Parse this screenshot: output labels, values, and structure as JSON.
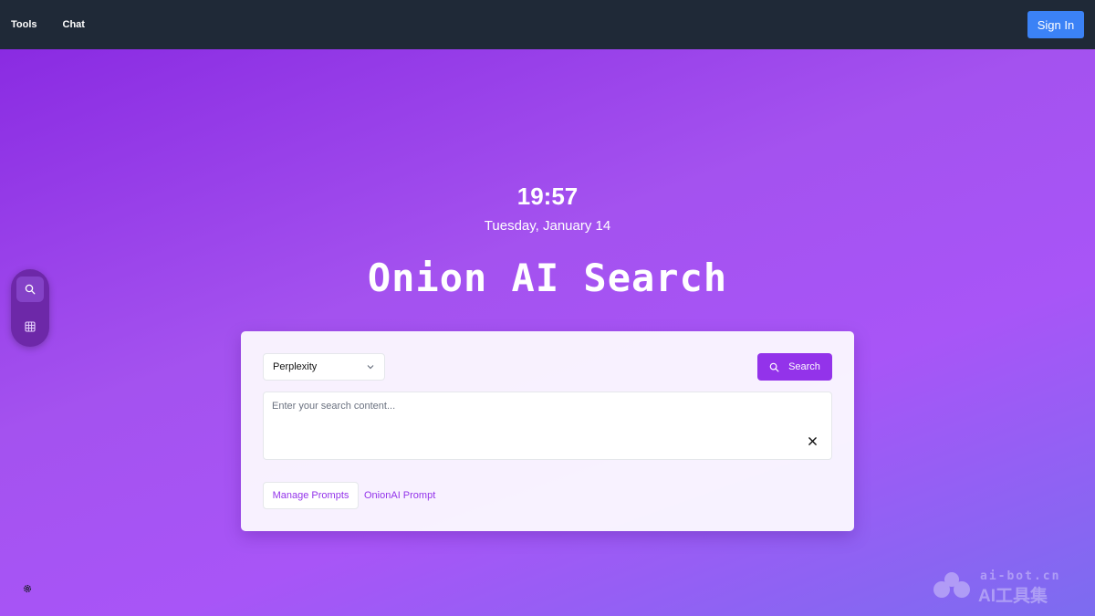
{
  "header": {
    "nav": [
      "Tools",
      "Chat"
    ],
    "sign_in_label": "Sign In"
  },
  "clock": {
    "time": "19:57",
    "date": "Tuesday, January 14"
  },
  "brand": {
    "title": "Onion AI Search"
  },
  "sidebar": {
    "items": [
      {
        "icon": "search-icon",
        "active": true
      },
      {
        "icon": "grid-icon",
        "active": false
      }
    ]
  },
  "search": {
    "engine": "Perplexity",
    "button_label": "Search",
    "placeholder": "Enter your search content...",
    "value": ""
  },
  "prompts": {
    "manage_label": "Manage Prompts",
    "link_label": "OnionAI Prompt"
  },
  "watermark": {
    "url": "ai-bot.cn",
    "name": "AI工具集"
  },
  "colors": {
    "topbar": "#1f2937",
    "accent": "#9333ea",
    "sign_in": "#3b82f6"
  }
}
